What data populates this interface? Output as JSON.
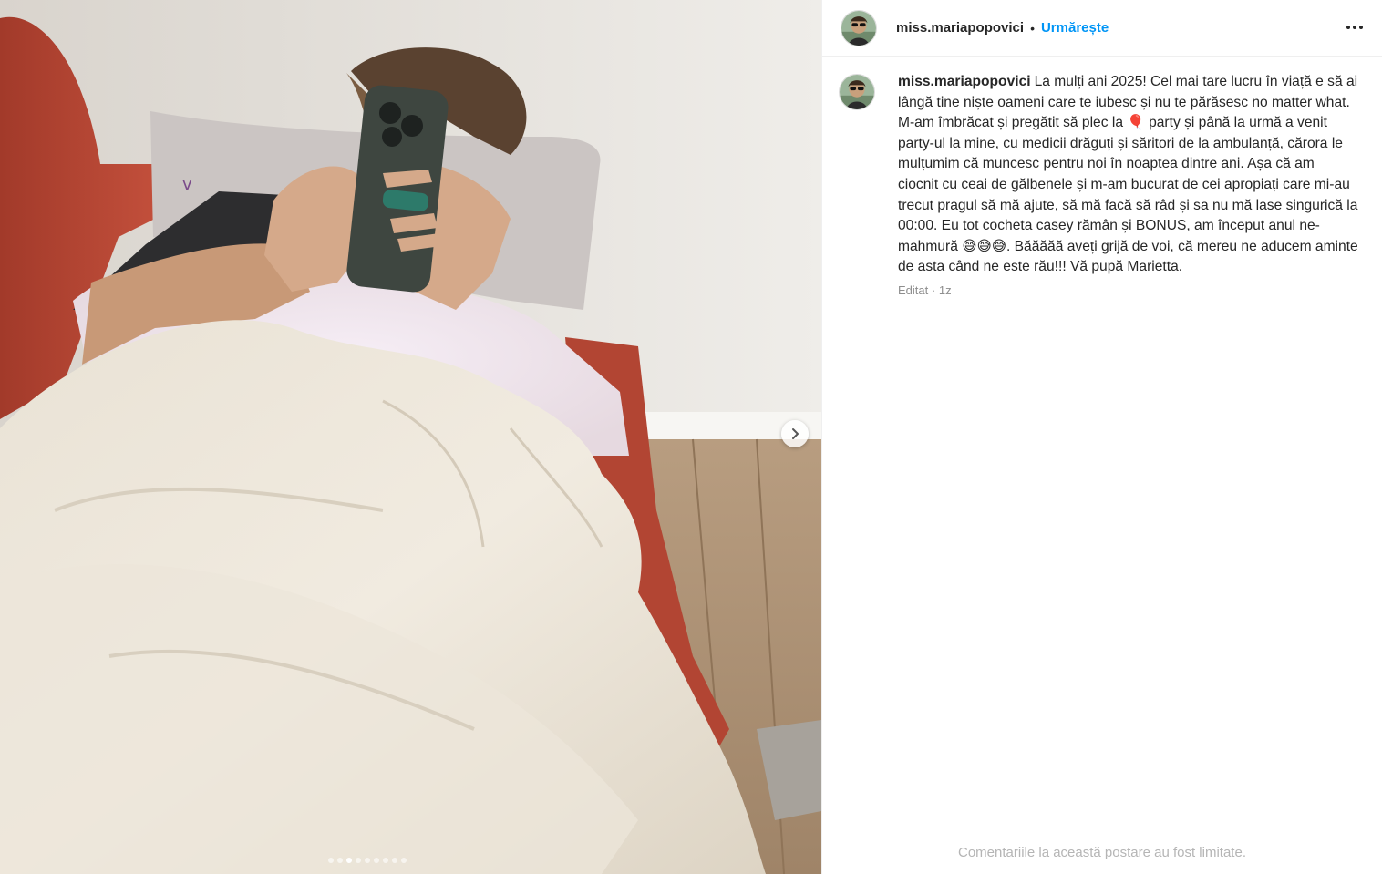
{
  "post": {
    "username": "miss.mariapopovici",
    "separator": "•",
    "follow_label": "Urmărește",
    "more_icon": "more-horizontal-icon",
    "caption": "La mulți ani 2025! Cel mai tare lucru în viață e să ai lângă tine niște oameni care te iubesc și nu te părăsesc no matter what. M-am îmbrăcat și pregătit să plec la 🎈 party și până la urmă a venit party-ul la mine, cu medicii drăguți și săritori de la ambulanță, cărora le mulțumim că muncesc pentru noi în noaptea dintre ani. Așa că am ciocnit cu ceai de gălbenele și m-am bucurat de cei apropiați care mi-au trecut pragul să mă ajute, să mă facă să râd și sa nu mă lase singurică la 00:00. Eu tot cocheta casey rămân și BONUS, am început anul ne-mahmură 😅😅😅. Băăăăă aveți grijă de voi, că mereu ne aducem aminte de asta când ne este rău!!! Vă pupă Marietta.",
    "edited_label": "Editat",
    "meta_separator": "·",
    "time_ago": "1z",
    "comments_limited": "Comentariile la această postare au fost limitate."
  },
  "carousel": {
    "total_slides": 9,
    "active_index": 2,
    "next_icon": "chevron-right-icon"
  },
  "colors": {
    "link_blue": "#0095f6",
    "text": "#262626",
    "muted": "#8e8e8e",
    "border": "#efefef"
  }
}
